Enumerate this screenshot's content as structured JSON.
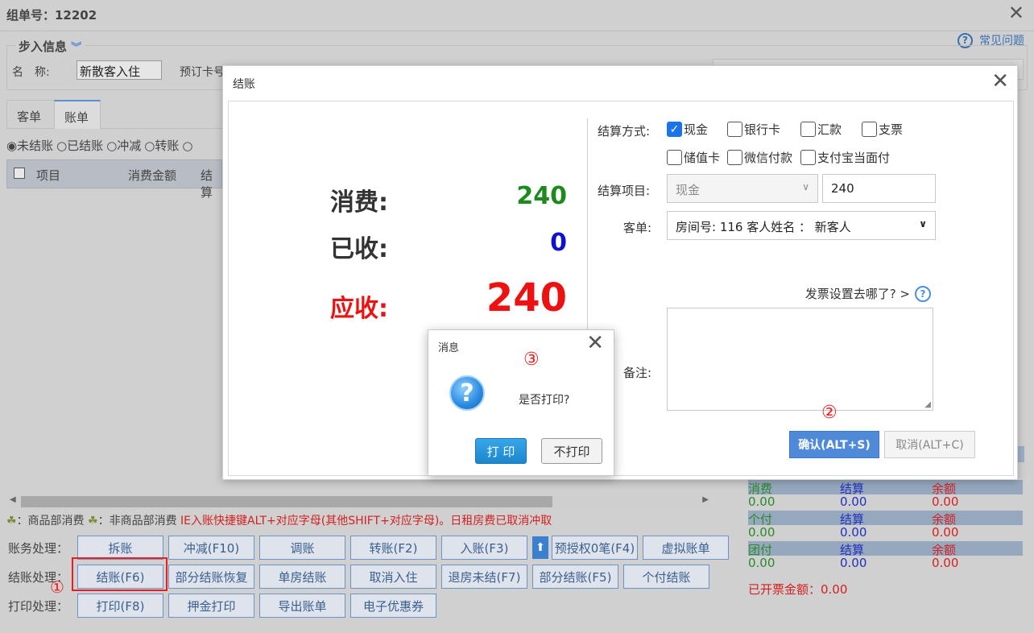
{
  "background": {
    "title": "组单号：12202",
    "faq_label": "常见问题",
    "section_title": "步入信息",
    "name_label": "名　称:",
    "name_value": "新散客入住",
    "booking_label": "预订卡号",
    "tabs": [
      "客单",
      "账单"
    ],
    "filters": [
      "◉未结账",
      "○已结账",
      "○冲减",
      "○转账",
      "○"
    ],
    "grid_headers": [
      "项目",
      "消费金额",
      "结算"
    ],
    "legend_goods": "：商品部消费",
    "legend_nongoods": "：非商品部消费",
    "legend_hint": "IE入账快捷键ALT+对应字母(其他SHIFT+对应字母)。日租房费已取消冲取",
    "rows": [
      {
        "label": "账务处理：",
        "buttons": [
          "拆账",
          "冲减(F10)",
          "调账",
          "转账(F2)",
          "入账(F3)",
          "预授权0笔(F4)",
          "虚拟账单"
        ]
      },
      {
        "label": "结账处理：",
        "buttons": [
          "结账(F6)",
          "部分结账恢复",
          "单房结账",
          "取消入住",
          "退房未结(F7)",
          "部分结账(F5)",
          "个付结账"
        ]
      },
      {
        "label": "打印处理：",
        "buttons": [
          "打印(F8)",
          "押金打印",
          "导出账单",
          "电子优惠券"
        ]
      }
    ],
    "annotation_1": "①",
    "summary": [
      {
        "head": [
          "消费",
          "结算",
          "余额"
        ],
        "values": [
          "0.00",
          "0.00",
          "0.00"
        ]
      },
      {
        "head": [
          "个付",
          "结算",
          "余额"
        ],
        "values": [
          "0.00",
          "0.00",
          "0.00"
        ]
      },
      {
        "head": [
          "团付",
          "结算",
          "余额"
        ],
        "values": [
          "0.00",
          "0.00",
          "0.00"
        ]
      }
    ],
    "invoiced": "已开票金额：0.00"
  },
  "dialog": {
    "title": "结账",
    "consume_label": "消费:",
    "consume_value": "240",
    "received_label": "已收:",
    "received_value": "0",
    "due_label": "应收:",
    "due_value": "240",
    "method_label": "结算方式:",
    "methods": [
      "现金",
      "银行卡",
      "汇款",
      "支票",
      "储值卡",
      "微信付款",
      "支付宝当面付"
    ],
    "item_label": "结算项目:",
    "item_select": "现金",
    "item_amount": "240",
    "guest_label": "客单:",
    "guest_select": "房间号: 116 客人姓名 ： 新客人",
    "invoice_question": "发票设置去哪了? >",
    "memo_label": "备注:",
    "confirm_button": "确认(ALT+S)",
    "cancel_button": "取消(ALT+C)",
    "annotation_2": "②"
  },
  "message": {
    "title": "消息",
    "annotation_3": "③",
    "text": "是否打印?",
    "print_button": "打 印",
    "no_print_button": "不打印"
  },
  "colors": {
    "consume": "#1e8a1e",
    "received": "#1010d0",
    "due": "#ee1111",
    "primary_button": "#4f8ad8",
    "annotation": "#ee1c1c"
  }
}
